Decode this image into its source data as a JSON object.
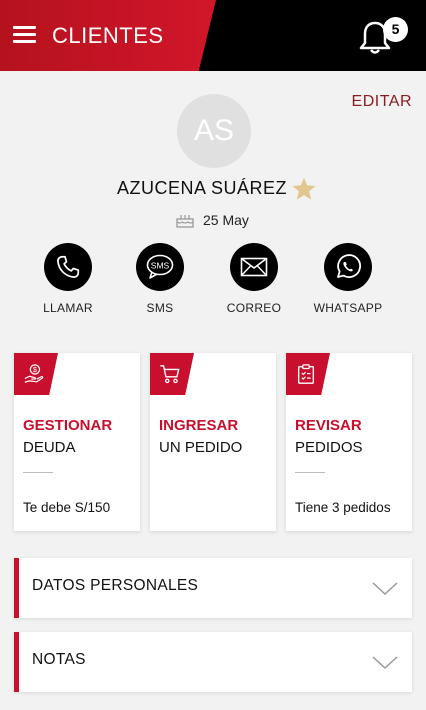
{
  "header": {
    "title": "CLIENTES",
    "notifications_count": "5"
  },
  "profile": {
    "edit_label": "EDITAR",
    "initials": "AS",
    "name": "AZUCENA SUÁREZ",
    "birthday": "25 May"
  },
  "actions": [
    {
      "label": "LLAMAR",
      "icon": "phone-icon"
    },
    {
      "label": "SMS",
      "icon": "sms-icon"
    },
    {
      "label": "CORREO",
      "icon": "mail-icon"
    },
    {
      "label": "WHATSAPP",
      "icon": "whatsapp-icon"
    }
  ],
  "cards": [
    {
      "title": "GESTIONAR",
      "subtitle": "DEUDA",
      "footer": "Te debe S/150",
      "icon": "money-hand-icon"
    },
    {
      "title": "INGRESAR",
      "subtitle": "UN PEDIDO",
      "footer": "",
      "icon": "cart-icon"
    },
    {
      "title": "REVISAR",
      "subtitle": "PEDIDOS",
      "footer": "Tiene 3 pedidos",
      "icon": "clipboard-icon"
    }
  ],
  "sections": [
    {
      "title": "DATOS PERSONALES"
    },
    {
      "title": "NOTAS"
    }
  ],
  "colors": {
    "accent": "#c8102e",
    "header_bg": "#000000",
    "edit": "#8a1d24",
    "star": "#e2c58f"
  }
}
